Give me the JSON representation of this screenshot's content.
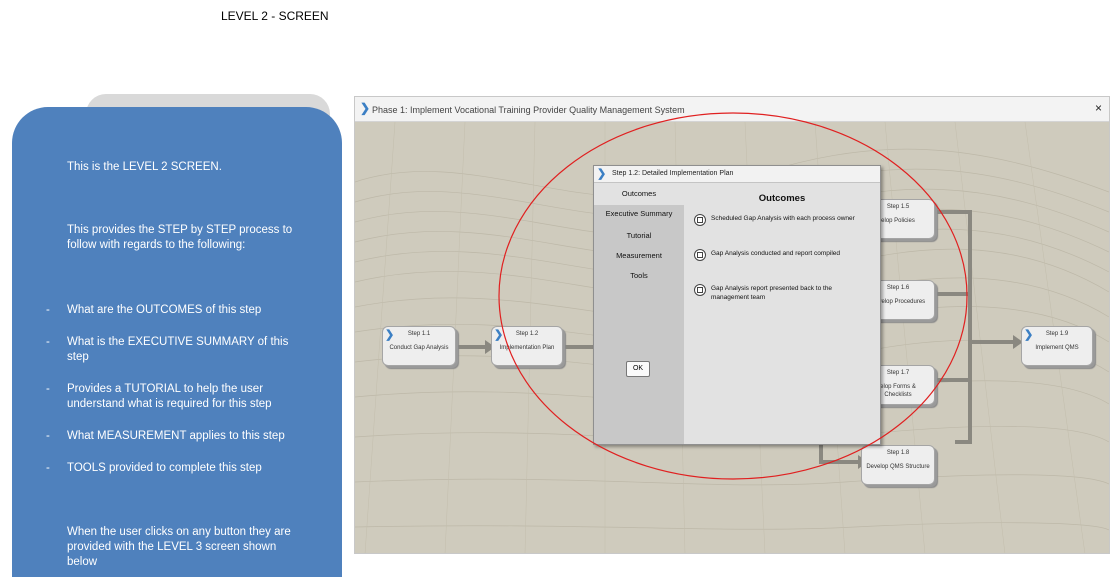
{
  "page": {
    "heading": "LEVEL 2 - SCREEN"
  },
  "notes": {
    "intro": "This is the LEVEL 2 SCREEN.",
    "description": "This provides the STEP by STEP process to follow with regards to the following:",
    "bullet_symbol": "-",
    "bullets": [
      "What are the OUTCOMES of this step",
      "What is the EXECUTIVE SUMMARY  of this step",
      "Provides a TUTORIAL to help the user understand what is required for this step",
      "What MEASUREMENT applies to this step",
      "TOOLS provided to complete this step"
    ],
    "footer": "When the user clicks on any button they are provided with the LEVEL 3 screen shown below",
    "panel_color": "#4f81bd"
  },
  "window": {
    "title": "Phase 1: Implement Vocational Training Provider  Quality Management System",
    "close_icon": "×",
    "chevron_icon": "❯",
    "steps": {
      "s11": {
        "number": "Step 1.1",
        "name": "Conduct Gap Analysis"
      },
      "s12": {
        "number": "Step 1.2",
        "name": "Implementation Plan"
      },
      "s15": {
        "number": "Step 1.5",
        "name": "elop Policies"
      },
      "s16": {
        "number": "Step 1.6",
        "name": "Develop Procedures"
      },
      "s17": {
        "number": "Step 1.7",
        "name": "elop Forms & Checklists"
      },
      "s18": {
        "number": "Step 1.8",
        "name": "Develop QMS Structure"
      },
      "s19": {
        "number": "Step 1.9",
        "name": "Implement QMS"
      }
    }
  },
  "dialog": {
    "title": "Step 1.2: Detailed Implementation Plan",
    "tabs": [
      "Outcomes",
      "Executive Summary",
      "Tutorial",
      "Measurement",
      "Tools"
    ],
    "ok_label": "OK",
    "heading": "Outcomes",
    "outcomes": [
      "Scheduled Gap Analysis with each process owner",
      "Gap Analysis conducted and report compiled",
      "Gap Analysis report presented back to the management team"
    ]
  },
  "annotation": {
    "circle_color": "#e02020"
  }
}
